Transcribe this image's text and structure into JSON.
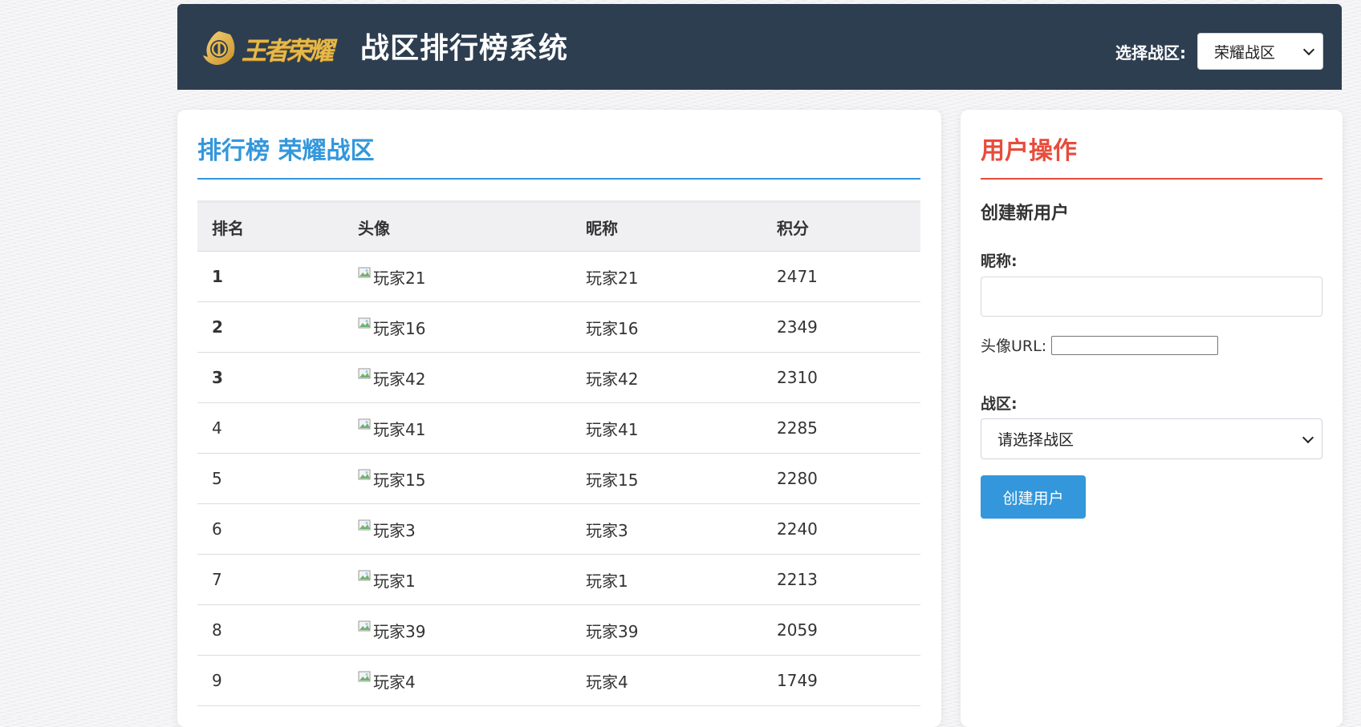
{
  "header": {
    "logo_text": "王者荣耀",
    "title": "战区排行榜系统",
    "zone_select_label": "选择战区:",
    "zone_selected": "荣耀战区"
  },
  "leaderboard": {
    "title": "排行榜 荣耀战区",
    "columns": [
      "排名",
      "头像",
      "昵称",
      "积分"
    ],
    "rows": [
      {
        "rank": "1",
        "avatar_alt": "玩家21",
        "nickname": "玩家21",
        "score": "2471"
      },
      {
        "rank": "2",
        "avatar_alt": "玩家16",
        "nickname": "玩家16",
        "score": "2349"
      },
      {
        "rank": "3",
        "avatar_alt": "玩家42",
        "nickname": "玩家42",
        "score": "2310"
      },
      {
        "rank": "4",
        "avatar_alt": "玩家41",
        "nickname": "玩家41",
        "score": "2285"
      },
      {
        "rank": "5",
        "avatar_alt": "玩家15",
        "nickname": "玩家15",
        "score": "2280"
      },
      {
        "rank": "6",
        "avatar_alt": "玩家3",
        "nickname": "玩家3",
        "score": "2240"
      },
      {
        "rank": "7",
        "avatar_alt": "玩家1",
        "nickname": "玩家1",
        "score": "2213"
      },
      {
        "rank": "8",
        "avatar_alt": "玩家39",
        "nickname": "玩家39",
        "score": "2059"
      },
      {
        "rank": "9",
        "avatar_alt": "玩家4",
        "nickname": "玩家4",
        "score": "1749"
      }
    ]
  },
  "user_ops": {
    "title": "用户操作",
    "form_heading": "创建新用户",
    "nickname_label": "昵称:",
    "nickname_value": "",
    "avatar_label": "头像URL:",
    "avatar_value": "",
    "zone_label": "战区:",
    "zone_placeholder": "请选择战区",
    "create_button": "创建用户"
  },
  "colors": {
    "header_bg": "#2d3e50",
    "accent_blue": "#3497db",
    "accent_red": "#e74c3c",
    "gold": "#f1c40f",
    "silver": "#bdc3c7",
    "bronze": "#cd7f32"
  },
  "icons": {
    "logo": "game-emblem-icon",
    "broken_image": "broken-image-icon",
    "dropdown": "chevron-down-icon"
  }
}
